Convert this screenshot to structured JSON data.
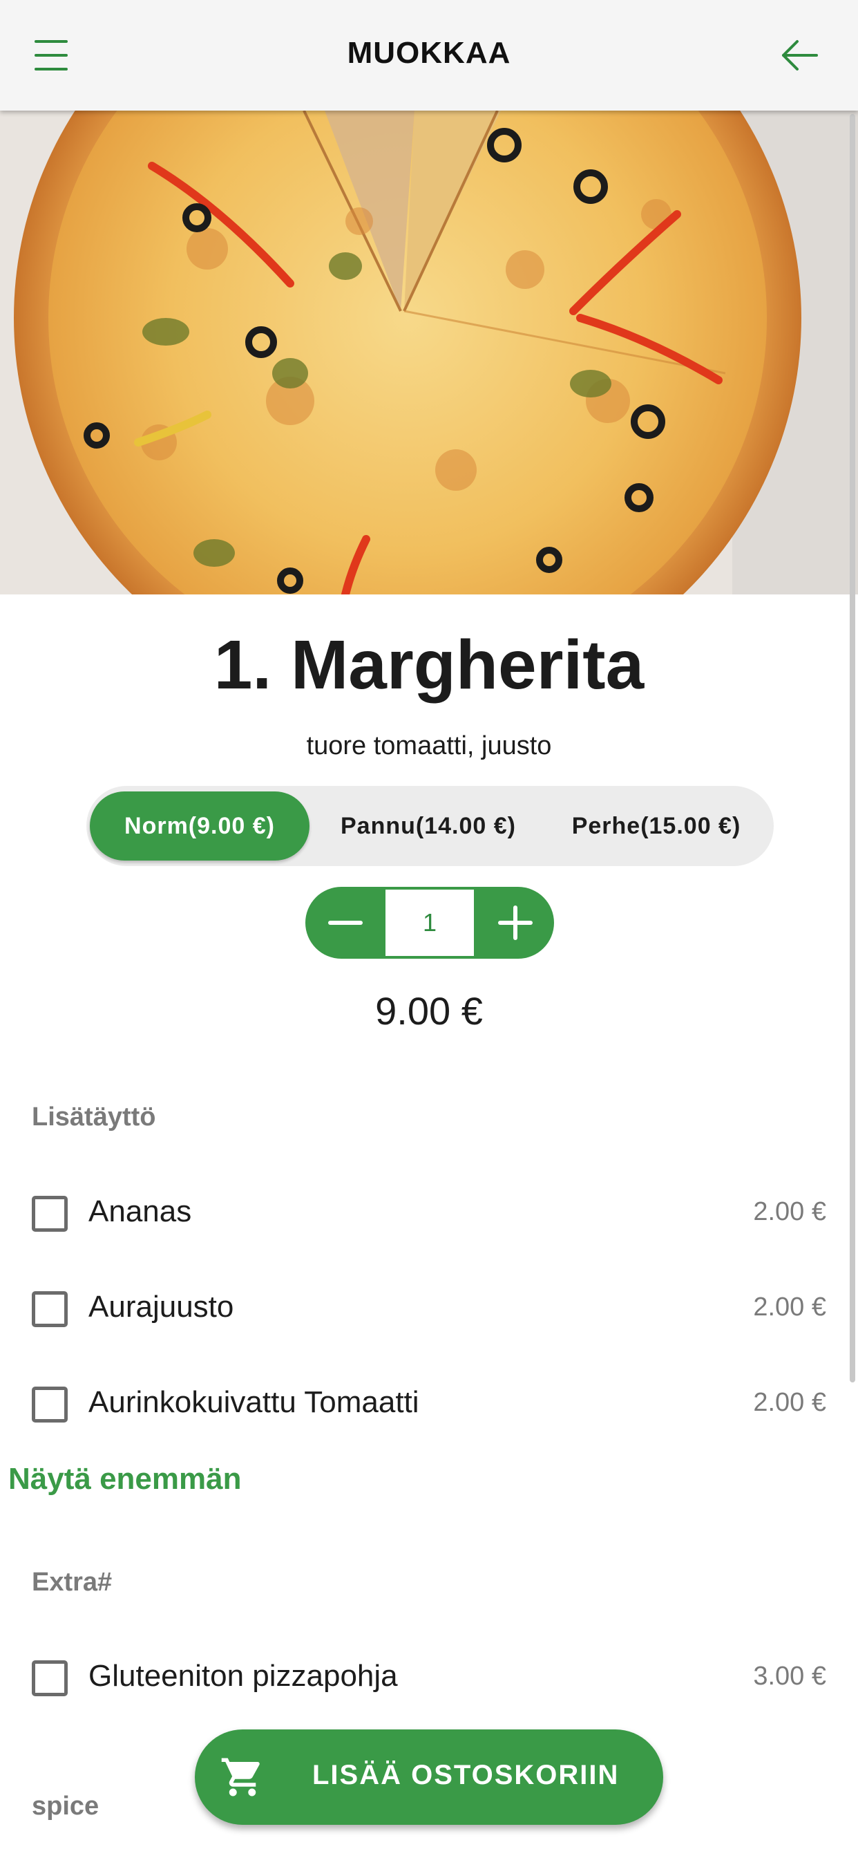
{
  "header": {
    "title": "MUOKKAA",
    "menu_icon": "hamburger-menu-icon",
    "back_icon": "arrow-left-icon"
  },
  "product": {
    "image_alt": "pizza",
    "name": "1. Margherita",
    "description": "tuore tomaatti, juusto",
    "sizes": [
      {
        "label": "Norm(9.00 €)",
        "selected": true
      },
      {
        "label": "Pannu(14.00 €)",
        "selected": false
      },
      {
        "label": "Perhe(15.00 €)",
        "selected": false
      }
    ],
    "quantity": "1",
    "price": "9.00 €"
  },
  "sections": [
    {
      "title": "Lisätäyttö",
      "options": [
        {
          "label": "Ananas",
          "price": "2.00 €",
          "checked": false
        },
        {
          "label": "Aurajuusto",
          "price": "2.00 €",
          "checked": false
        },
        {
          "label": "Aurinkokuivattu Tomaatti",
          "price": "2.00 €",
          "checked": false
        }
      ],
      "show_more": "Näytä enemmän"
    },
    {
      "title": "Extra#",
      "options": [
        {
          "label": "Gluteeniton pizzapohja",
          "price": "3.00 €",
          "checked": false
        }
      ]
    },
    {
      "title": "spice",
      "options": []
    }
  ],
  "cart_button": {
    "label": "LISÄÄ OSTOSKORIIN",
    "icon": "shopping-cart-icon"
  },
  "colors": {
    "accent": "#3a9a47",
    "appbar_bg": "#f5f5f5",
    "secondary_text": "#7a7a7a"
  }
}
